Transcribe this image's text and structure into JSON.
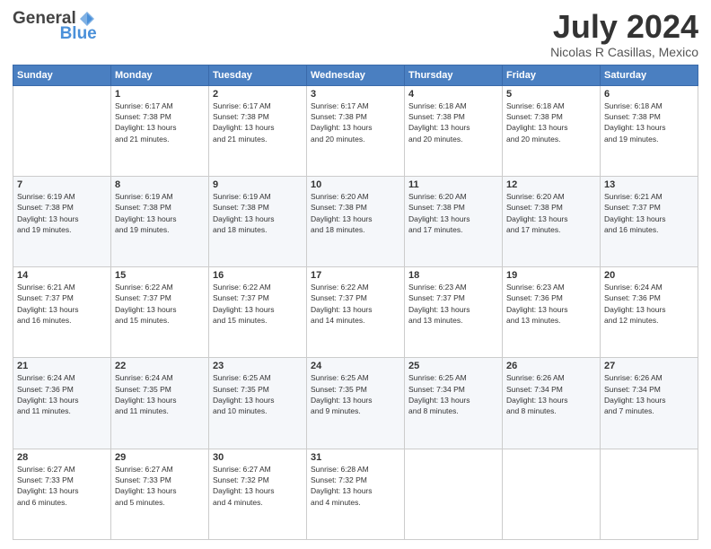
{
  "logo": {
    "text_general": "General",
    "text_blue": "Blue"
  },
  "header": {
    "month_title": "July 2024",
    "location": "Nicolas R Casillas, Mexico"
  },
  "days_of_week": [
    "Sunday",
    "Monday",
    "Tuesday",
    "Wednesday",
    "Thursday",
    "Friday",
    "Saturday"
  ],
  "weeks": [
    [
      {
        "day": "",
        "sunrise": "",
        "sunset": "",
        "daylight": ""
      },
      {
        "day": "1",
        "sunrise": "6:17 AM",
        "sunset": "7:38 PM",
        "daylight": "13 hours and 21 minutes."
      },
      {
        "day": "2",
        "sunrise": "6:17 AM",
        "sunset": "7:38 PM",
        "daylight": "13 hours and 21 minutes."
      },
      {
        "day": "3",
        "sunrise": "6:17 AM",
        "sunset": "7:38 PM",
        "daylight": "13 hours and 20 minutes."
      },
      {
        "day": "4",
        "sunrise": "6:18 AM",
        "sunset": "7:38 PM",
        "daylight": "13 hours and 20 minutes."
      },
      {
        "day": "5",
        "sunrise": "6:18 AM",
        "sunset": "7:38 PM",
        "daylight": "13 hours and 20 minutes."
      },
      {
        "day": "6",
        "sunrise": "6:18 AM",
        "sunset": "7:38 PM",
        "daylight": "13 hours and 19 minutes."
      }
    ],
    [
      {
        "day": "7",
        "sunrise": "6:19 AM",
        "sunset": "7:38 PM",
        "daylight": "13 hours and 19 minutes."
      },
      {
        "day": "8",
        "sunrise": "6:19 AM",
        "sunset": "7:38 PM",
        "daylight": "13 hours and 19 minutes."
      },
      {
        "day": "9",
        "sunrise": "6:19 AM",
        "sunset": "7:38 PM",
        "daylight": "13 hours and 18 minutes."
      },
      {
        "day": "10",
        "sunrise": "6:20 AM",
        "sunset": "7:38 PM",
        "daylight": "13 hours and 18 minutes."
      },
      {
        "day": "11",
        "sunrise": "6:20 AM",
        "sunset": "7:38 PM",
        "daylight": "13 hours and 17 minutes."
      },
      {
        "day": "12",
        "sunrise": "6:20 AM",
        "sunset": "7:38 PM",
        "daylight": "13 hours and 17 minutes."
      },
      {
        "day": "13",
        "sunrise": "6:21 AM",
        "sunset": "7:37 PM",
        "daylight": "13 hours and 16 minutes."
      }
    ],
    [
      {
        "day": "14",
        "sunrise": "6:21 AM",
        "sunset": "7:37 PM",
        "daylight": "13 hours and 16 minutes."
      },
      {
        "day": "15",
        "sunrise": "6:22 AM",
        "sunset": "7:37 PM",
        "daylight": "13 hours and 15 minutes."
      },
      {
        "day": "16",
        "sunrise": "6:22 AM",
        "sunset": "7:37 PM",
        "daylight": "13 hours and 15 minutes."
      },
      {
        "day": "17",
        "sunrise": "6:22 AM",
        "sunset": "7:37 PM",
        "daylight": "13 hours and 14 minutes."
      },
      {
        "day": "18",
        "sunrise": "6:23 AM",
        "sunset": "7:37 PM",
        "daylight": "13 hours and 13 minutes."
      },
      {
        "day": "19",
        "sunrise": "6:23 AM",
        "sunset": "7:36 PM",
        "daylight": "13 hours and 13 minutes."
      },
      {
        "day": "20",
        "sunrise": "6:24 AM",
        "sunset": "7:36 PM",
        "daylight": "13 hours and 12 minutes."
      }
    ],
    [
      {
        "day": "21",
        "sunrise": "6:24 AM",
        "sunset": "7:36 PM",
        "daylight": "13 hours and 11 minutes."
      },
      {
        "day": "22",
        "sunrise": "6:24 AM",
        "sunset": "7:35 PM",
        "daylight": "13 hours and 11 minutes."
      },
      {
        "day": "23",
        "sunrise": "6:25 AM",
        "sunset": "7:35 PM",
        "daylight": "13 hours and 10 minutes."
      },
      {
        "day": "24",
        "sunrise": "6:25 AM",
        "sunset": "7:35 PM",
        "daylight": "13 hours and 9 minutes."
      },
      {
        "day": "25",
        "sunrise": "6:25 AM",
        "sunset": "7:34 PM",
        "daylight": "13 hours and 8 minutes."
      },
      {
        "day": "26",
        "sunrise": "6:26 AM",
        "sunset": "7:34 PM",
        "daylight": "13 hours and 8 minutes."
      },
      {
        "day": "27",
        "sunrise": "6:26 AM",
        "sunset": "7:34 PM",
        "daylight": "13 hours and 7 minutes."
      }
    ],
    [
      {
        "day": "28",
        "sunrise": "6:27 AM",
        "sunset": "7:33 PM",
        "daylight": "13 hours and 6 minutes."
      },
      {
        "day": "29",
        "sunrise": "6:27 AM",
        "sunset": "7:33 PM",
        "daylight": "13 hours and 5 minutes."
      },
      {
        "day": "30",
        "sunrise": "6:27 AM",
        "sunset": "7:32 PM",
        "daylight": "13 hours and 4 minutes."
      },
      {
        "day": "31",
        "sunrise": "6:28 AM",
        "sunset": "7:32 PM",
        "daylight": "13 hours and 4 minutes."
      },
      {
        "day": "",
        "sunrise": "",
        "sunset": "",
        "daylight": ""
      },
      {
        "day": "",
        "sunrise": "",
        "sunset": "",
        "daylight": ""
      },
      {
        "day": "",
        "sunrise": "",
        "sunset": "",
        "daylight": ""
      }
    ]
  ],
  "labels": {
    "sunrise": "Sunrise:",
    "sunset": "Sunset:",
    "daylight": "Daylight:"
  },
  "colors": {
    "header_bg": "#4a7fc1",
    "accent": "#4a90d9"
  }
}
